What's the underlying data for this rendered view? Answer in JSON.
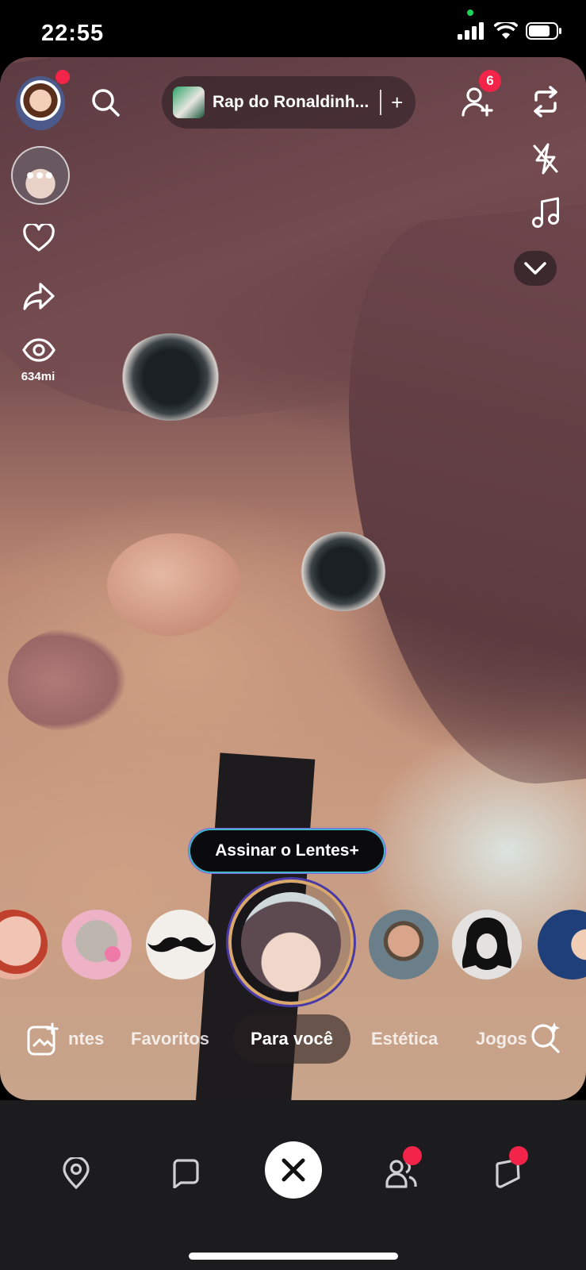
{
  "status_bar": {
    "time": "22:55"
  },
  "camera": {
    "song": {
      "title": "Rap do Ronaldinh...",
      "add_symbol": "+"
    },
    "friend_requests_badge": "6",
    "views_label": "634mi",
    "lens_avatar_dots": "•••"
  },
  "subscribe_button": "Assinar o Lentes+",
  "lens_tabs": [
    "ntes",
    "Favoritos",
    "Para você",
    "Estética",
    "Jogos"
  ],
  "active_tab": "Para você",
  "colors": {
    "accent_red": "#f2244a",
    "bottom_bar": "#1c1c1e",
    "ring_gold": "#d8a96a",
    "ring_purple": "#4a3aa8",
    "ring_cyan": "#3fb6c8"
  },
  "icons": [
    "search-icon",
    "add-friend-icon",
    "flip-camera-icon",
    "flash-off-icon",
    "music-note-icon",
    "chevron-down-icon",
    "heart-icon",
    "share-icon",
    "eye-icon",
    "add-photo-icon",
    "lens-search-icon",
    "map-pin-icon",
    "chat-icon",
    "close-icon",
    "friends-icon",
    "stories-icon"
  ]
}
